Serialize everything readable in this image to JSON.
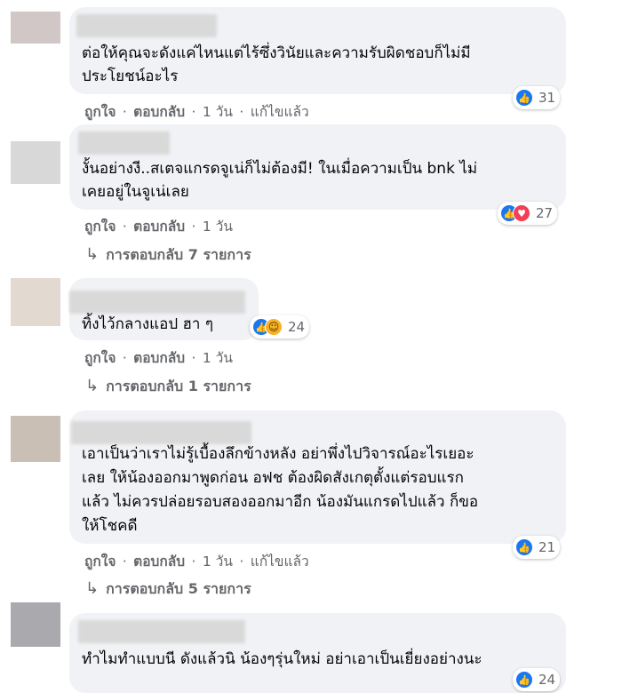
{
  "comments": [
    {
      "text": [
        "ต่อให้คุณจะดังแค่ไหนแต่ไร้ซึ่งวินัยและความรับผิดชอบก็ไม่มี",
        "ประโยชน์อะไร"
      ],
      "like_label": "ถูกใจ",
      "reply_label": "ตอบกลับ",
      "time": "1 วัน",
      "edited_label": "แก้ไขแล้ว",
      "reaction_icons": [
        "like-icon"
      ],
      "reaction_count": "31"
    },
    {
      "text": [
        "งั้นอย่างงี..สเตจแกรดจูเน่ก็ไม่ต้องมี! ในเมื่อความเป็น bnk ไม่",
        "เคยอยู่ในจูเน่เลย"
      ],
      "like_label": "ถูกใจ",
      "reply_label": "ตอบกลับ",
      "time": "1 วัน",
      "reaction_icons": [
        "like-icon",
        "love-icon"
      ],
      "reaction_count": "27",
      "replies_label": "การตอบกลับ 7 รายการ"
    },
    {
      "text": [
        "ทิ้งไว้กลางแอป ฮา ๆ"
      ],
      "like_label": "ถูกใจ",
      "reply_label": "ตอบกลับ",
      "time": "1 วัน",
      "reaction_icons": [
        "like-icon",
        "haha-icon"
      ],
      "reaction_count": "24",
      "replies_label": "การตอบกลับ 1 รายการ"
    },
    {
      "text": [
        "เอาเป็นว่าเราไม่รู้เบื้องลึกข้างหลัง อย่าพึ่งไปวิจารณ์อะไรเยอะ",
        "เลย ให้น้องออกมาพูดก่อน อฟช ต้องผิดสังเกตุตั้งแต่รอบแรก",
        "แล้ว ไม่ควรปล่อยรอบสองออกมาอีก น้องมันแกรดไปแล้ว ก็ขอ",
        "ให้โชคดี"
      ],
      "like_label": "ถูกใจ",
      "reply_label": "ตอบกลับ",
      "time": "1 วัน",
      "edited_label": "แก้ไขแล้ว",
      "reaction_icons": [
        "like-icon"
      ],
      "reaction_count": "21",
      "replies_label": "การตอบกลับ 5 รายการ"
    },
    {
      "text": [
        "ทำไมทำแบบนี ดังแล้วนิ น้องๆรุ่นใหม่ อย่าเอาเป็นเยี่ยงอย่างนะ"
      ],
      "reaction_icons": [
        "like-icon"
      ],
      "reaction_count": "24"
    }
  ],
  "separator": "·",
  "reply_arrow": "↳",
  "colors": {
    "accent": "#1877f2",
    "bubble": "#f0f2f5",
    "meta": "#65676b"
  }
}
